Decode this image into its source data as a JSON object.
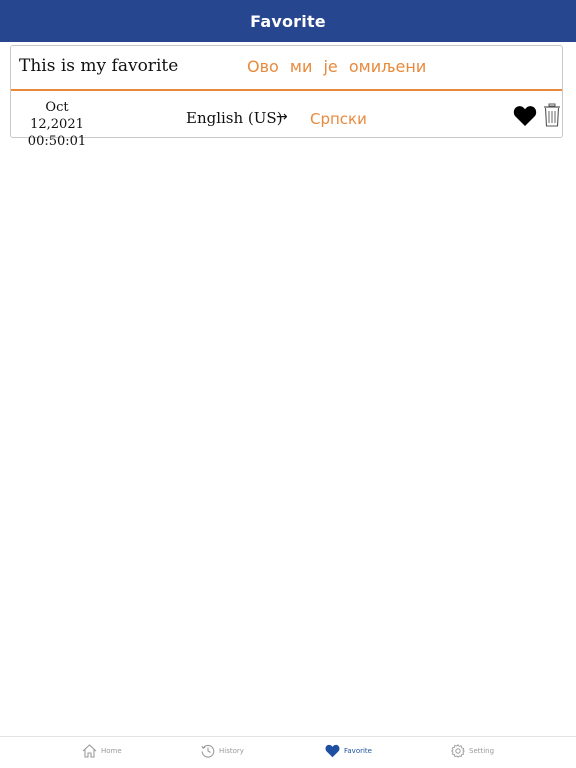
{
  "header": {
    "title": "Favorite"
  },
  "favorite_item": {
    "source_text": "This is my favorite",
    "translated_text": "Ово ми је омиљени",
    "date": "Oct 12,2021",
    "time": "00:50:01",
    "source_language": "English (US)",
    "arrow": "→",
    "target_language": "Српски",
    "favorite_icon": "heart-filled-icon",
    "delete_icon": "trash-icon"
  },
  "tabs": [
    {
      "label": "Home",
      "icon": "home-icon",
      "active": false
    },
    {
      "label": "History",
      "icon": "history-icon",
      "active": false
    },
    {
      "label": "Favorite",
      "icon": "heart-icon",
      "active": true
    },
    {
      "label": "Setting",
      "icon": "gear-icon",
      "active": false
    }
  ],
  "colors": {
    "header_bg": "#274690",
    "accent_orange": "#e88a3c",
    "active_tab": "#1f4fa0",
    "inactive_tab": "#9a9a9a"
  }
}
